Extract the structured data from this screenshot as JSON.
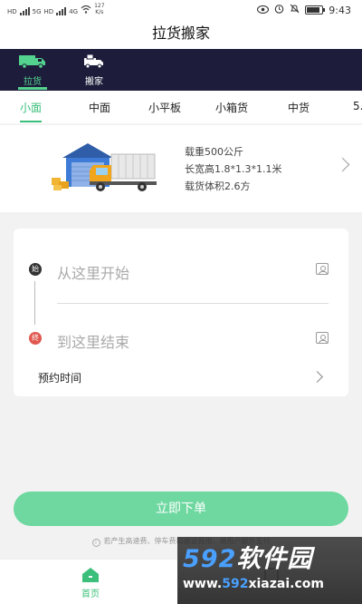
{
  "status_bar": {
    "net_speed": "127\nK/s",
    "net_speed_value": "127",
    "net_speed_unit": "K/s",
    "time": "9:43",
    "left_tags": [
      "HD",
      "5G",
      "HD",
      "4G"
    ]
  },
  "header": {
    "title": "拉货搬家"
  },
  "top_nav": [
    {
      "label": "拉货",
      "icon": "truck-icon",
      "active": true
    },
    {
      "label": "搬家",
      "icon": "moving-truck-icon",
      "active": false
    }
  ],
  "categories": [
    {
      "label": "小面",
      "active": true
    },
    {
      "label": "中面",
      "active": false
    },
    {
      "label": "小平板",
      "active": false
    },
    {
      "label": "小箱货",
      "active": false
    },
    {
      "label": "中货",
      "active": false
    },
    {
      "label": "5.",
      "active": false
    }
  ],
  "vehicle": {
    "load": "载重500公斤",
    "dimensions": "长宽高1.8*1.3*1.1米",
    "volume": "载货体积2.6方"
  },
  "address": {
    "start_badge": "始",
    "start_placeholder": "从这里开始",
    "end_badge": "终",
    "end_placeholder": "到这里结束",
    "time_label": "预约时间"
  },
  "order_button": "立即下单",
  "notice": "若产生高速费、停车费和搬运费用，请用户额外支付",
  "bottom_tabs": [
    {
      "label": "首页",
      "icon": "home-icon",
      "active": true
    },
    {
      "label": "",
      "icon": "orders-icon",
      "active": false
    }
  ],
  "watermark": {
    "title_num": "592",
    "title_text": "软件园",
    "url_prefix": "www.",
    "url_num": "592",
    "url_suffix": "xiazai.com"
  },
  "colors": {
    "accent": "#3bbf7a",
    "nav_bg": "#1d1d3b",
    "button": "#6ed8a0",
    "end_pin": "#e0574f"
  }
}
